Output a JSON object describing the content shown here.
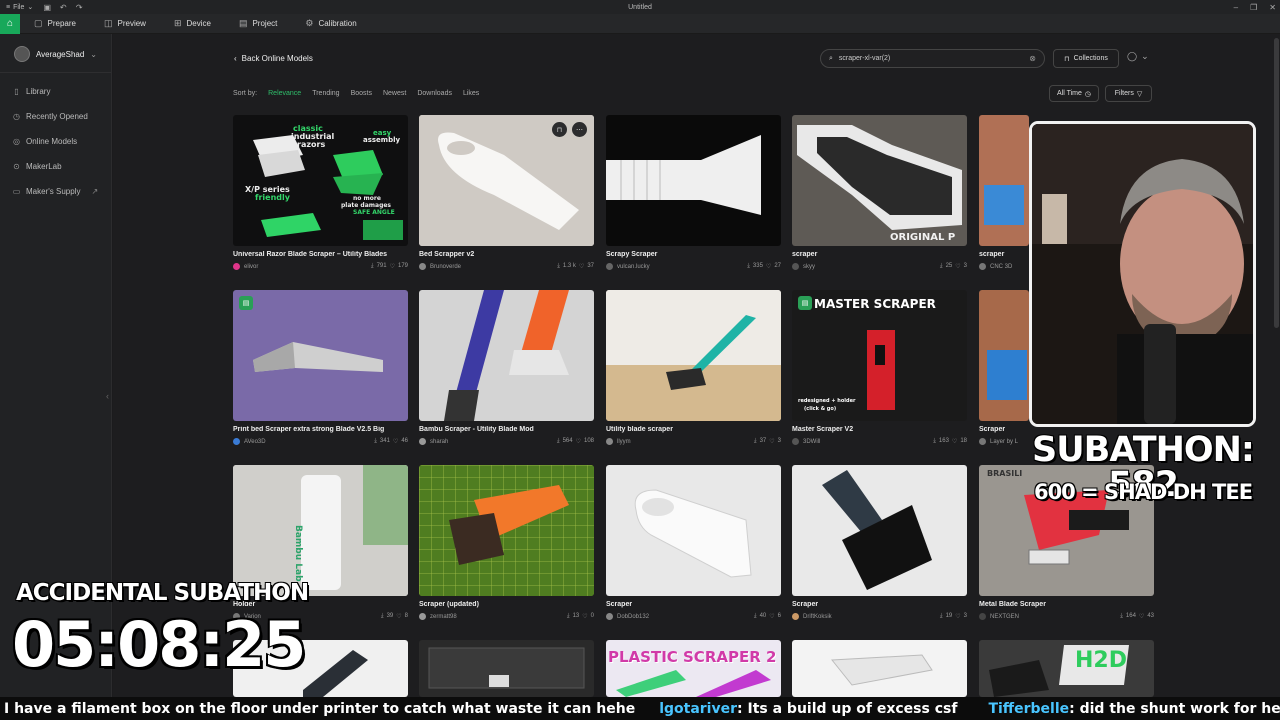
{
  "titlebar": {
    "file_label": "File",
    "window_title": "Untitled"
  },
  "topnav": {
    "tabs": [
      {
        "label": "Prepare",
        "icon": "prepare-icon"
      },
      {
        "label": "Preview",
        "icon": "preview-icon"
      },
      {
        "label": "Device",
        "icon": "device-icon"
      },
      {
        "label": "Project",
        "icon": "project-icon"
      },
      {
        "label": "Calibration",
        "icon": "calibration-icon"
      }
    ]
  },
  "sidebar": {
    "username": "AverageShad",
    "items": [
      {
        "label": "Library"
      },
      {
        "label": "Recently Opened"
      },
      {
        "label": "Online Models"
      },
      {
        "label": "MakerLab"
      },
      {
        "label": "Maker's Supply"
      }
    ]
  },
  "header": {
    "back_label": "Back Online Models",
    "search_value": "scraper-xl-var(2)",
    "collections_label": "Collections",
    "all_time_label": "All Time",
    "filters_label": "Filters"
  },
  "sort": {
    "label": "Sort by:",
    "options": [
      "Relevance",
      "Trending",
      "Boosts",
      "Newest",
      "Downloads",
      "Likes"
    ],
    "active": "Relevance"
  },
  "cards": [
    {
      "title": "Universal Razor Blade Scraper – Utility Blades",
      "author": "elivor",
      "downloads": "791",
      "likes": "179"
    },
    {
      "title": "Bed Scrapper v2",
      "author": "Brunoverde",
      "downloads": "1.3 k",
      "likes": "37"
    },
    {
      "title": "Scrapy Scraper",
      "author": "vulcan.lucky",
      "downloads": "335",
      "likes": "27"
    },
    {
      "title": "scraper",
      "author": "skyy",
      "downloads": "25",
      "likes": "3"
    },
    {
      "title": "scraper",
      "author": "CNC 3D",
      "downloads": "",
      "likes": ""
    },
    {
      "title": "Print bed Scraper extra strong Blade V2.5 Big",
      "author": "AVeo3D",
      "downloads": "341",
      "likes": "46"
    },
    {
      "title": "Bambu Scraper - Utility Blade Mod",
      "author": "sharah",
      "downloads": "564",
      "likes": "108"
    },
    {
      "title": "Utility blade scraper",
      "author": "llyym",
      "downloads": "37",
      "likes": "3"
    },
    {
      "title": "Master Scraper V2",
      "author": "3DWill",
      "downloads": "163",
      "likes": "18"
    },
    {
      "title": "Scraper",
      "author": "Layer by L",
      "downloads": "",
      "likes": ""
    },
    {
      "title": "Holder",
      "author": "Varion",
      "downloads": "39",
      "likes": "8"
    },
    {
      "title": "Scraper (updated)",
      "author": "zermatt98",
      "downloads": "13",
      "likes": "0"
    },
    {
      "title": "Scraper",
      "author": "DobDob132",
      "downloads": "40",
      "likes": "6"
    },
    {
      "title": "Scraper",
      "author": "DriftKoksik",
      "downloads": "19",
      "likes": "3"
    },
    {
      "title": "Metal Blade Scraper",
      "author": "NEXTGEN",
      "downloads": "164",
      "likes": "43"
    },
    {
      "title": "",
      "author": "",
      "downloads": "",
      "likes": ""
    },
    {
      "title": "",
      "author": "",
      "downloads": "",
      "likes": ""
    },
    {
      "title": "",
      "author": "",
      "downloads": "",
      "likes": ""
    },
    {
      "title": "",
      "author": "",
      "downloads": "",
      "likes": ""
    },
    {
      "title": "",
      "author": "",
      "downloads": "",
      "likes": ""
    }
  ],
  "thumb_text": {
    "c1_line1": "classic",
    "c1_line2": "industrial",
    "c1_line3": "razors",
    "c1_easy": "easy",
    "c1_assembly": "assembly",
    "c1_xp": "X/P series",
    "c1_friendly": "friendly",
    "c1_noplate": "no more",
    "c1_plate": "plate damages",
    "c1_safe": "SAFE ANGLE",
    "c4_original": "ORIGINAL P",
    "c9_master": "MASTER SCRAPER",
    "c9_redesign": "redesigned + holder",
    "c9_click": "(click & go)",
    "c11_brand": "Bambu Lab",
    "c15_brasil": "BRASILI",
    "c18_plastic": "PLASTIC SCRAPER 2",
    "c20_h2d": "H2D"
  },
  "stream": {
    "subathon_count": "SUBATHON: 582",
    "goal": "600 = SHAD DH TEE",
    "timer_label": "ACCIDENTAL SUBATHON",
    "timer": "05:08:25",
    "chat": [
      {
        "user": "",
        "text": "I have a filament box on the floor under printer to catch what waste it can hehe"
      },
      {
        "user": "lgotariver",
        "text": ":  Its a build up of excess csf"
      },
      {
        "user": "Tifferbelle",
        "text": ":  did the shunt work for her?"
      }
    ]
  },
  "colors": {
    "accent": "#18a85a",
    "background": "#1d1d1f"
  }
}
